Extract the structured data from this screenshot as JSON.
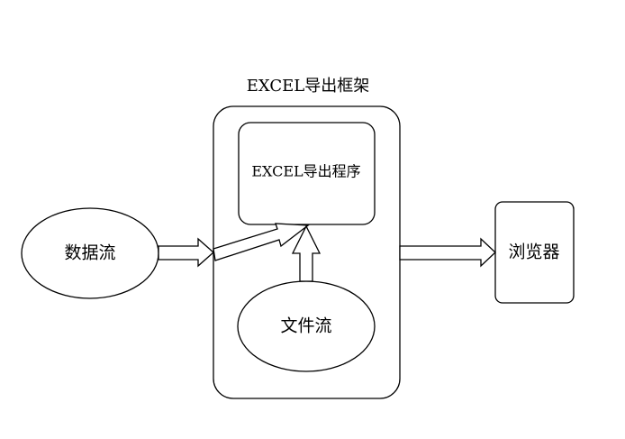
{
  "diagram": {
    "frame_title": "EXCEL导出框架",
    "export_program": "EXCEL导出程序",
    "data_stream": "数据流",
    "file_stream": "文件流",
    "browser": "浏览器"
  },
  "colors": {
    "stroke": "#000000",
    "fill": "#ffffff"
  }
}
